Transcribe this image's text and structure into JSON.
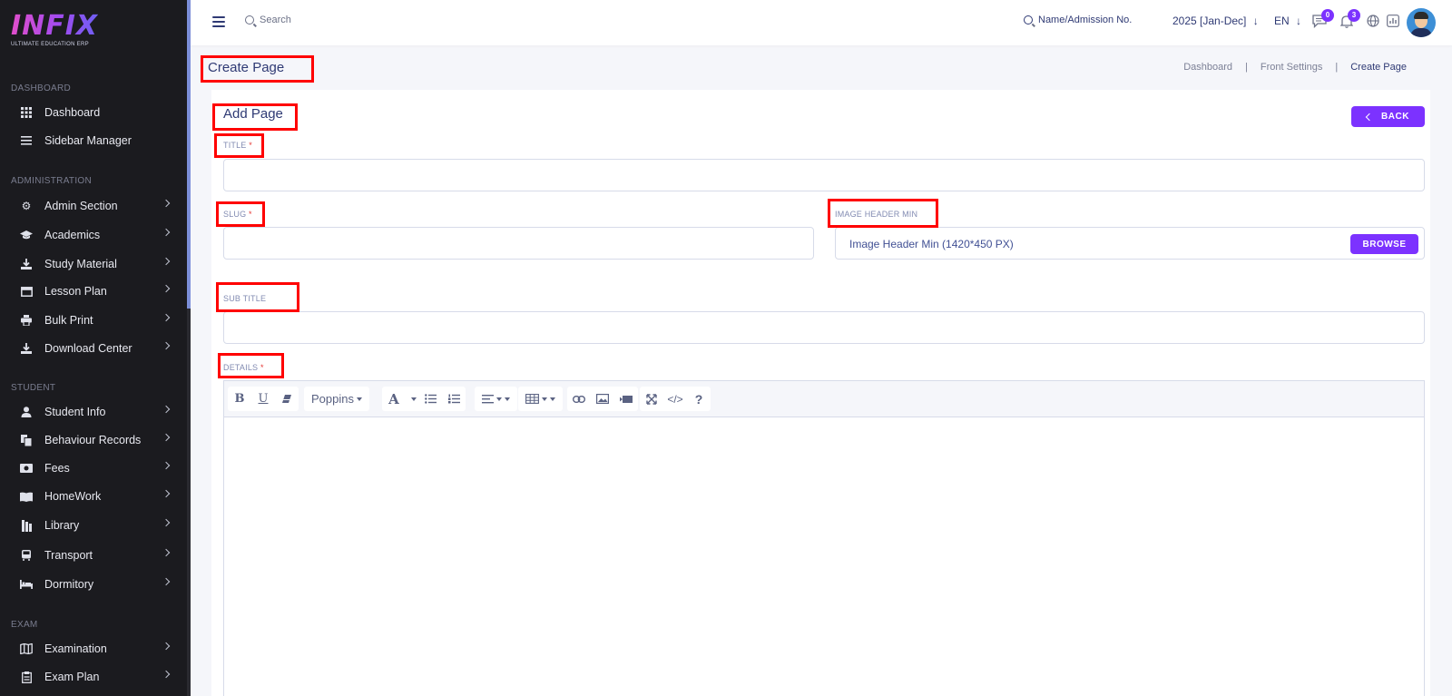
{
  "brand": {
    "logo": "INFIX",
    "tagline": "ULTIMATE EDUCATION ERP"
  },
  "sidebar": {
    "sections": [
      {
        "label": "DASHBOARD"
      },
      {
        "label": "ADMINISTRATION"
      },
      {
        "label": "STUDENT"
      },
      {
        "label": "EXAM"
      }
    ],
    "items": [
      {
        "label": "Dashboard",
        "icon": "grid-icon"
      },
      {
        "label": "Sidebar Manager",
        "icon": "list-icon"
      },
      {
        "label": "Admin Section",
        "icon": "admin-icon"
      },
      {
        "label": "Academics",
        "icon": "graduation-cap-icon"
      },
      {
        "label": "Study Material",
        "icon": "download-icon"
      },
      {
        "label": "Lesson Plan",
        "icon": "book-icon"
      },
      {
        "label": "Bulk Print",
        "icon": "printer-icon"
      },
      {
        "label": "Download Center",
        "icon": "download-icon"
      },
      {
        "label": "Student Info",
        "icon": "user-icon"
      },
      {
        "label": "Behaviour Records",
        "icon": "files-icon"
      },
      {
        "label": "Fees",
        "icon": "money-icon"
      },
      {
        "label": "HomeWork",
        "icon": "book-open-icon"
      },
      {
        "label": "Library",
        "icon": "library-icon"
      },
      {
        "label": "Transport",
        "icon": "bus-icon"
      },
      {
        "label": "Dormitory",
        "icon": "bed-icon"
      },
      {
        "label": "Examination",
        "icon": "map-icon"
      },
      {
        "label": "Exam Plan",
        "icon": "clipboard-icon"
      }
    ]
  },
  "topbar": {
    "search_label": "Search",
    "student_search_label": "Name/Admission No.",
    "academic_year": "2025 [Jan-Dec]",
    "language": "EN",
    "messages_count": "0",
    "notifications_count": "3"
  },
  "page": {
    "title": "Create Page",
    "breadcrumb": [
      "Dashboard",
      "Front Settings",
      "Create Page"
    ],
    "breadcrumb_sep": "|"
  },
  "form": {
    "heading": "Add Page",
    "back_label": "BACK",
    "title_label": "TITLE",
    "slug_label": "SLUG",
    "required_mark": "*",
    "image_header_label": "IMAGE HEADER MIN",
    "image_header_placeholder": "Image Header Min (1420*450 PX)",
    "browse_label": "BROWSE",
    "subtitle_label": "SUB TITLE",
    "details_label": "DETAILS",
    "title_value": "",
    "slug_value": "",
    "subtitle_value": ""
  },
  "editor": {
    "font_name": "Poppins",
    "font_color_glyph": "A",
    "help_glyph": "?",
    "code_glyph": "</>"
  },
  "colors": {
    "accent": "#7c32ff",
    "sidebar_bg": "#1b1b1f",
    "highlight": "#ff0000"
  }
}
